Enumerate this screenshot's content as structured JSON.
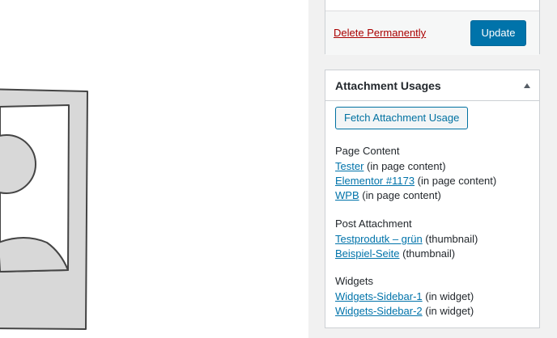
{
  "publish": {
    "delete_label": "Delete Permanently",
    "update_label": "Update"
  },
  "attachment_usages": {
    "title": "Attachment Usages",
    "fetch_label": "Fetch Attachment Usage",
    "groups": [
      {
        "title": "Page Content",
        "items": [
          {
            "link": "Tester",
            "note": " (in page content)"
          },
          {
            "link": "Elementor #1173",
            "note": " (in page content)"
          },
          {
            "link": "WPB",
            "note": " (in page content)"
          }
        ]
      },
      {
        "title": "Post Attachment",
        "items": [
          {
            "link": "Testprodutk – grün",
            "note": " (thumbnail)"
          },
          {
            "link": "Beispiel-Seite",
            "note": " (thumbnail)"
          }
        ]
      },
      {
        "title": "Widgets",
        "items": [
          {
            "link": "Widgets-Sidebar-1",
            "note": " (in widget)"
          },
          {
            "link": "Widgets-Sidebar-2",
            "note": " (in widget)"
          }
        ]
      }
    ]
  },
  "media_preview": {
    "icon": "image-placeholder-icon"
  },
  "colors": {
    "primary": "#0073aa",
    "delete": "#aa0000",
    "sidebar_bg": "#f1f1f1",
    "border": "#ccd0d4"
  }
}
